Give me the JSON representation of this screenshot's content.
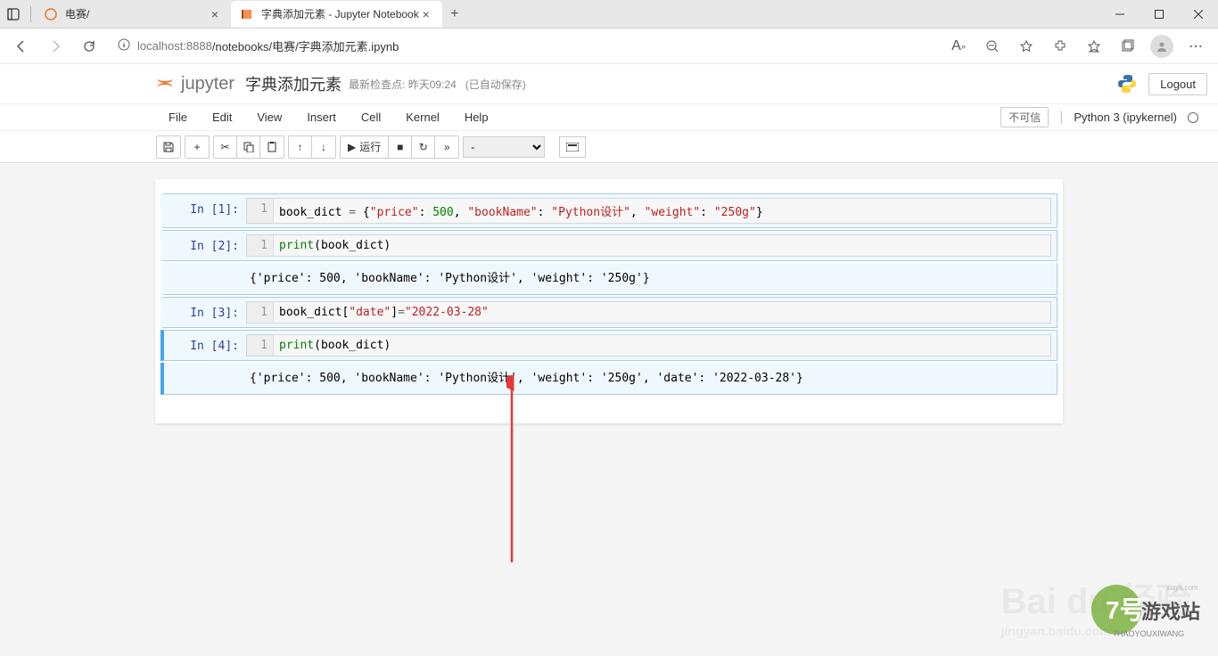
{
  "browser": {
    "tabs": [
      {
        "title": "电赛/",
        "favicon": "jupyter"
      },
      {
        "title": "字典添加元素 - Jupyter Notebook",
        "favicon": "book"
      }
    ],
    "url_prefix": "localhost",
    "url_port": ":8888",
    "url_path": "/notebooks/电赛/字典添加元素.ipynb"
  },
  "jupyter": {
    "logo_text": "jupyter",
    "notebook_title": "字典添加元素",
    "checkpoint_label": "最新检查点:",
    "checkpoint_time": "昨天09:24",
    "autosave": "(已自动保存)",
    "logout": "Logout",
    "menu": [
      "File",
      "Edit",
      "View",
      "Insert",
      "Cell",
      "Kernel",
      "Help"
    ],
    "trust": "不可信",
    "kernel": "Python 3 (ipykernel)",
    "run_label": "运行",
    "cell_type_options": [
      "-"
    ]
  },
  "cells": [
    {
      "prompt": "In [1]:",
      "line_no": "1",
      "code_html": "book_dict <span class='op'>=</span> {<span class='str'>\"price\"</span>: <span class='num'>500</span>, <span class='str'>\"bookName\"</span>: <span class='str'>\"Python设计\"</span>, <span class='str'>\"weight\"</span>: <span class='str'>\"250g\"</span>}",
      "output": ""
    },
    {
      "prompt": "In [2]:",
      "line_no": "1",
      "code_html": "<span class='fn'>print</span>(book_dict)",
      "output": "{'price': 500, 'bookName': 'Python设计', 'weight': '250g'}"
    },
    {
      "prompt": "In [3]:",
      "line_no": "1",
      "code_html": "book_dict[<span class='str'>\"date\"</span>]<span class='op'>=</span><span class='str'>\"2022-03-28\"</span>",
      "output": ""
    },
    {
      "prompt": "In [4]:",
      "line_no": "1",
      "code_html": "<span class='fn'>print</span>(book_dict)",
      "output": "{'price': 500, 'bookName': 'Python设计', 'weight': '250g', 'date': '2022-03-28'}"
    }
  ],
  "watermark": {
    "main": "Bai du 经验",
    "sub": "jingyan.baidu.com",
    "game": "7号游戏站",
    "game_sub": "7HAOYOUXIWANG"
  }
}
